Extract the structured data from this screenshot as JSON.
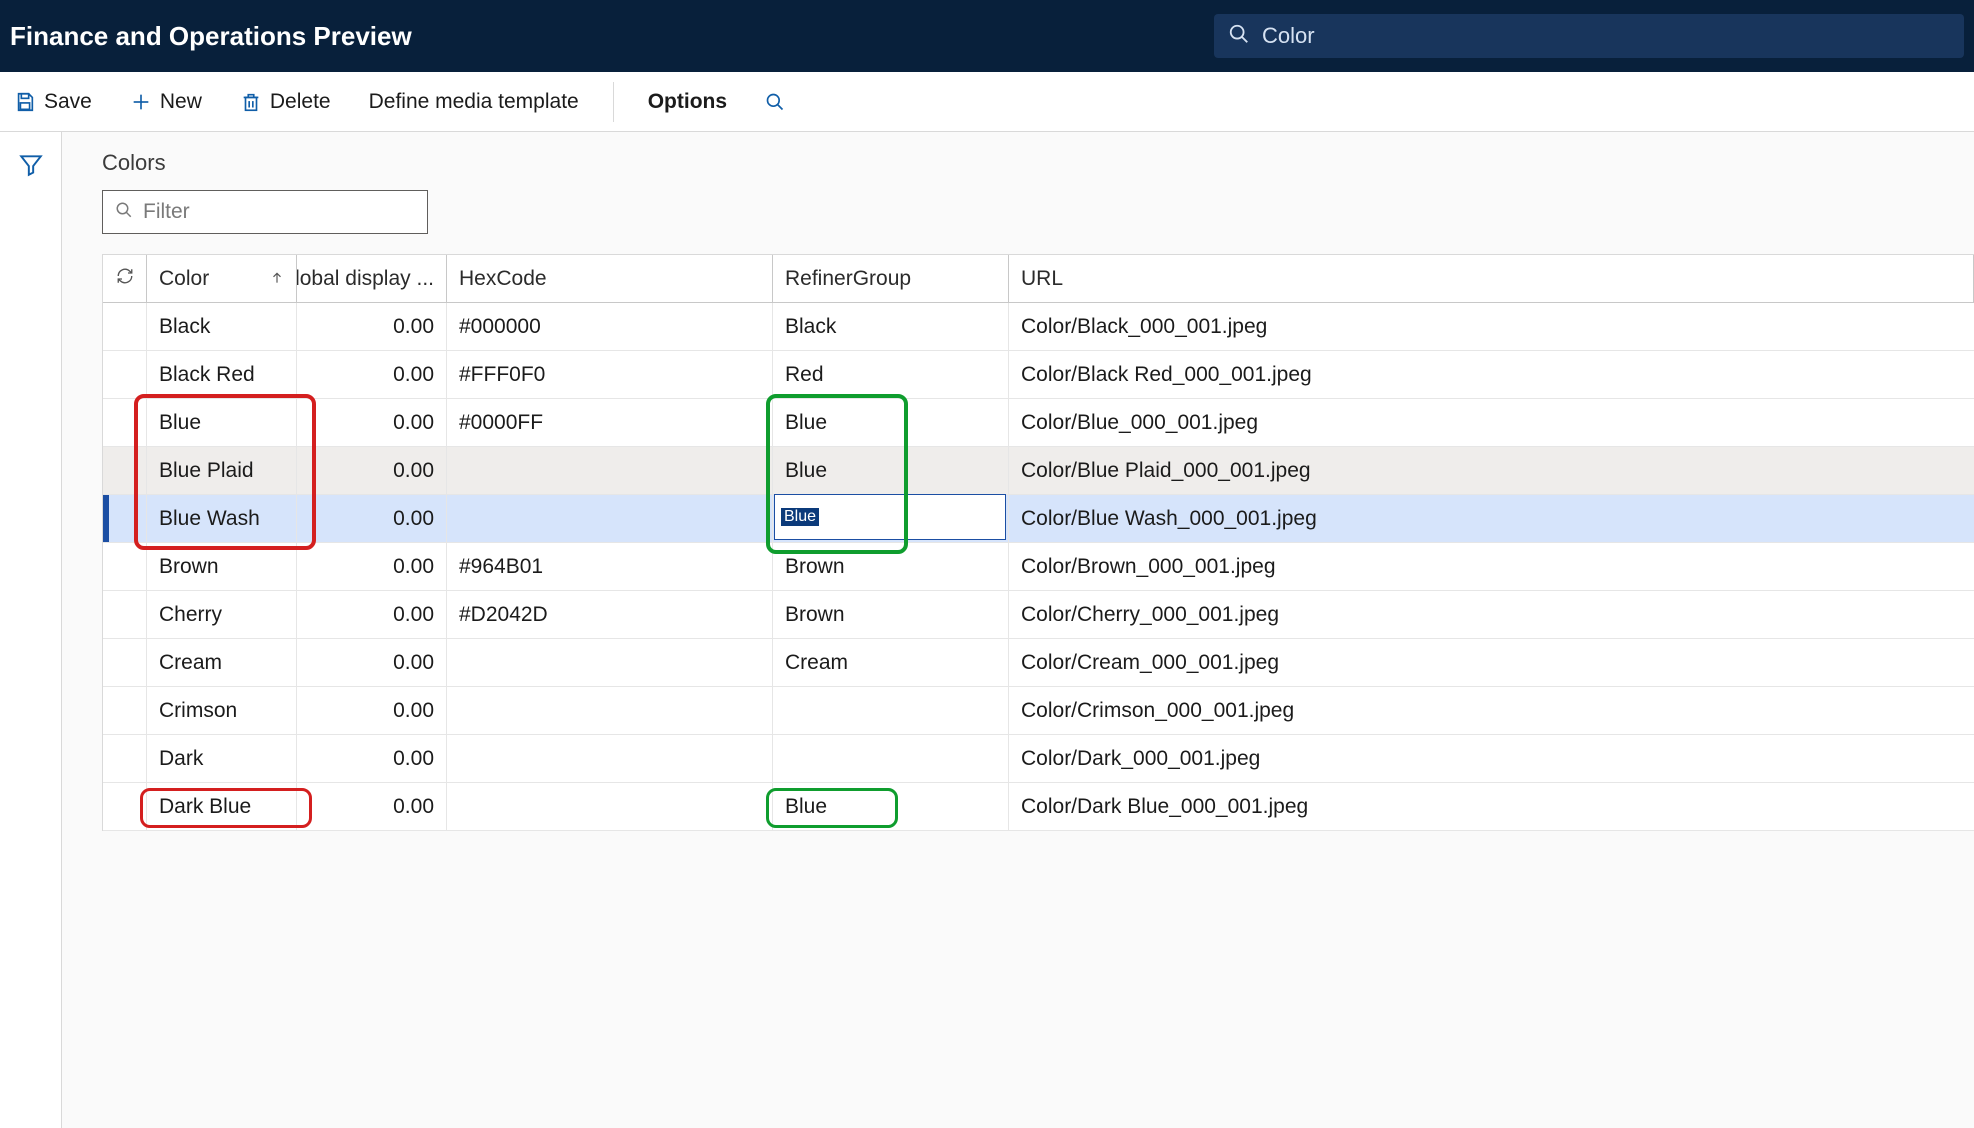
{
  "header": {
    "app_title": "Finance and Operations Preview",
    "search_value": "Color"
  },
  "toolbar": {
    "save": "Save",
    "new": "New",
    "delete": "Delete",
    "define_media": "Define media template",
    "options": "Options"
  },
  "page": {
    "title": "Colors",
    "filter_placeholder": "Filter"
  },
  "columns": {
    "color": "Color",
    "global_display": "Global display ...",
    "hexcode": "HexCode",
    "refiner": "RefinerGroup",
    "url": "URL"
  },
  "rows": [
    {
      "color": "Black",
      "global": "0.00",
      "hex": "#000000",
      "refiner": "Black",
      "url": "Color/Black_000_001.jpeg"
    },
    {
      "color": "Black Red",
      "global": "0.00",
      "hex": "#FFF0F0",
      "refiner": "Red",
      "url": "Color/Black Red_000_001.jpeg"
    },
    {
      "color": "Blue",
      "global": "0.00",
      "hex": "#0000FF",
      "refiner": "Blue",
      "url": "Color/Blue_000_001.jpeg"
    },
    {
      "color": "Blue Plaid",
      "global": "0.00",
      "hex": "",
      "refiner": "Blue",
      "url": "Color/Blue Plaid_000_001.jpeg"
    },
    {
      "color": "Blue Wash",
      "global": "0.00",
      "hex": "",
      "refiner": "Blue",
      "url": "Color/Blue Wash_000_001.jpeg"
    },
    {
      "color": "Brown",
      "global": "0.00",
      "hex": "#964B01",
      "refiner": "Brown",
      "url": "Color/Brown_000_001.jpeg"
    },
    {
      "color": "Cherry",
      "global": "0.00",
      "hex": "#D2042D",
      "refiner": "Brown",
      "url": "Color/Cherry_000_001.jpeg"
    },
    {
      "color": "Cream",
      "global": "0.00",
      "hex": "",
      "refiner": "Cream",
      "url": "Color/Cream_000_001.jpeg"
    },
    {
      "color": "Crimson",
      "global": "0.00",
      "hex": "",
      "refiner": "",
      "url": "Color/Crimson_000_001.jpeg"
    },
    {
      "color": "Dark",
      "global": "0.00",
      "hex": "",
      "refiner": "",
      "url": "Color/Dark_000_001.jpeg"
    },
    {
      "color": "Dark Blue",
      "global": "0.00",
      "hex": "",
      "refiner": "Blue",
      "url": "Color/Dark Blue_000_001.jpeg"
    }
  ],
  "editing": {
    "row_index": 4,
    "value": "Blue"
  },
  "alt_row_index": 3
}
